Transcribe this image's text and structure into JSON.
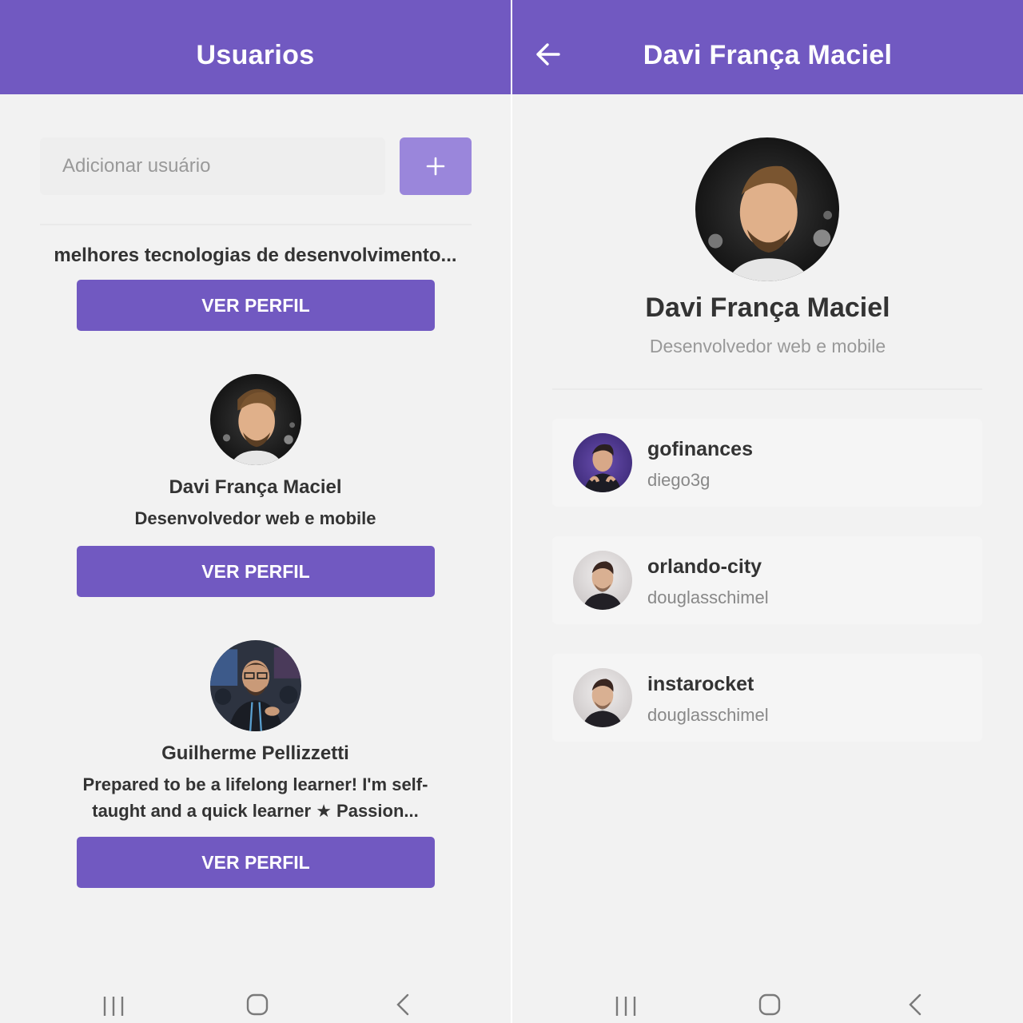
{
  "colors": {
    "primary": "#7159c1",
    "primary_light": "#9a86db",
    "background": "#f2f2f2",
    "text": "#333333",
    "muted": "#999999"
  },
  "left_screen": {
    "header": {
      "title": "Usuarios"
    },
    "search": {
      "placeholder": "Adicionar usuário",
      "add_icon": "plus-icon"
    },
    "cut_item": {
      "bio": "melhores tecnologias de desenvolvimento...",
      "button_label": "VER PERFIL"
    },
    "users": [
      {
        "name": "Davi França Maciel",
        "bio": "Desenvolvedor web e mobile",
        "button_label": "VER PERFIL"
      },
      {
        "name": "Guilherme Pellizzetti",
        "bio": "Prepared to be a lifelong learner! I'm self-taught and a quick learner ★ Passion...",
        "button_label": "VER PERFIL"
      }
    ]
  },
  "right_screen": {
    "header": {
      "title": "Davi França Maciel",
      "back_icon": "arrow-left-icon"
    },
    "profile": {
      "name": "Davi França Maciel",
      "bio": "Desenvolvedor web e mobile"
    },
    "repos": [
      {
        "name": "gofinances",
        "owner": "diego3g"
      },
      {
        "name": "orlando-city",
        "owner": "douglasschimel"
      },
      {
        "name": "instarocket",
        "owner": "douglasschimel"
      }
    ]
  },
  "navbar": {
    "icons": [
      "recent-apps-icon",
      "home-icon",
      "back-icon"
    ]
  }
}
